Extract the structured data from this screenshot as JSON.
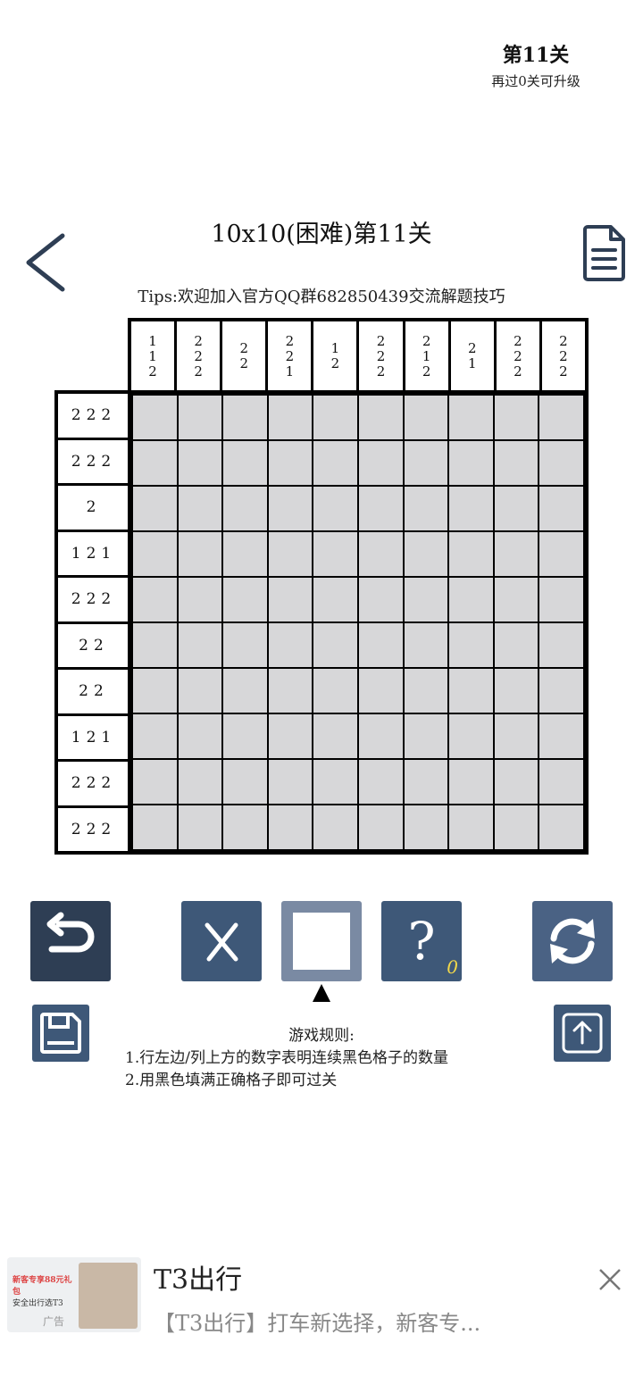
{
  "header": {
    "level_label": "第11关",
    "upgrade_hint": "再过0关可升级"
  },
  "puzzle": {
    "title": "10x10(困难)第11关",
    "tips": "Tips:欢迎加入官方QQ群682850439交流解题技巧",
    "column_clues": [
      [
        "1",
        "1",
        "2"
      ],
      [
        "2",
        "2",
        "2"
      ],
      [
        "2",
        "2"
      ],
      [
        "2",
        "2",
        "1"
      ],
      [
        "1",
        "2"
      ],
      [
        "2",
        "2",
        "2"
      ],
      [
        "2",
        "1",
        "2"
      ],
      [
        "2",
        "1"
      ],
      [
        "2",
        "2",
        "2"
      ],
      [
        "2",
        "2",
        "2"
      ]
    ],
    "row_clues": [
      "222",
      "222",
      "2",
      "121",
      "222",
      "22",
      "22",
      "121",
      "222",
      "222"
    ]
  },
  "toolbar": {
    "selected_tool": "fill-square",
    "hint_count": "0",
    "hint_symbol": "?",
    "cross_symbol": "X"
  },
  "rules": {
    "title": "游戏规则:",
    "line1": "1.行左边/列上方的数字表明连续黑色格子的数量",
    "line2": "2.用黑色填满正确格子即可过关"
  },
  "ad": {
    "title": "T3出行",
    "description": "【T3出行】打车新选择，新客专...",
    "label": "广告",
    "thumb_text1": "新客专享88元礼包",
    "thumb_text2": "安全出行选T3"
  },
  "colors": {
    "dark_button": "#2e3e54",
    "button": "#3e5878",
    "selected_button": "#7a8aa3",
    "cell_empty": "#d7d7d9"
  }
}
